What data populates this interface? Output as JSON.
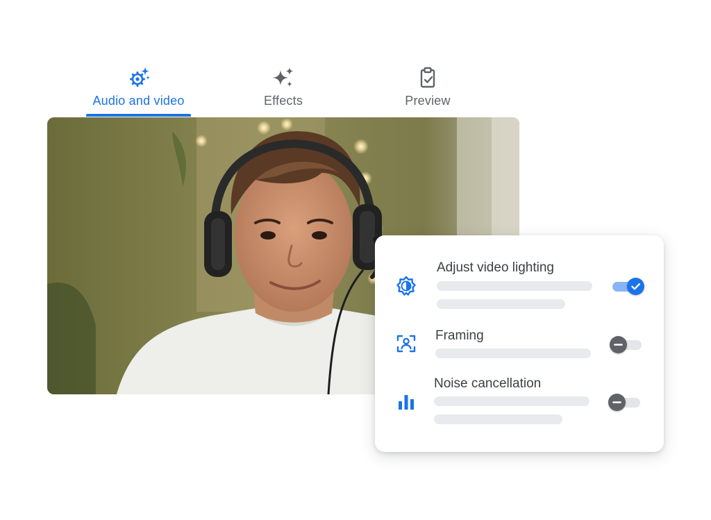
{
  "tabs": [
    {
      "label": "Audio and video",
      "icon": "settings-sparkle-icon",
      "active": true
    },
    {
      "label": "Effects",
      "icon": "sparkles-icon",
      "active": false
    },
    {
      "label": "Preview",
      "icon": "clipboard-check-icon",
      "active": false
    }
  ],
  "video": {
    "subject": "person-wearing-headphones"
  },
  "settings": [
    {
      "title": "Adjust video lighting",
      "icon": "brightness-icon",
      "enabled": true
    },
    {
      "title": "Framing",
      "icon": "framing-icon",
      "enabled": false
    },
    {
      "title": "Noise cancellation",
      "icon": "bar-chart-icon",
      "enabled": false
    }
  ],
  "colors": {
    "accent": "#1a73e8",
    "accent_light": "#8ab4f8",
    "text": "#3c4043",
    "muted": "#5f6368",
    "skeleton": "#e8eaed"
  }
}
